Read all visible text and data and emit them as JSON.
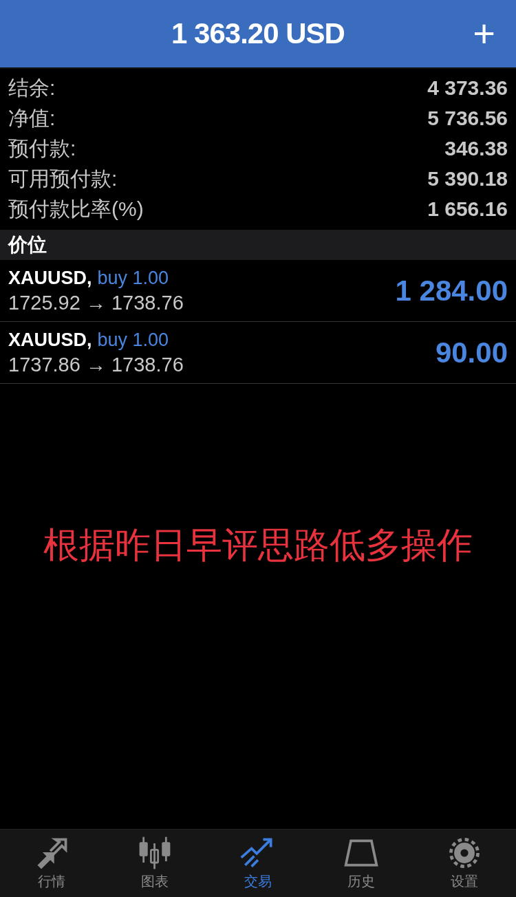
{
  "header": {
    "title": "1 363.20 USD",
    "add_icon": "+"
  },
  "summary": [
    {
      "label": "结余:",
      "value": "4 373.36"
    },
    {
      "label": "净值:",
      "value": "5 736.56"
    },
    {
      "label": "预付款:",
      "value": "346.38"
    },
    {
      "label": "可用预付款:",
      "value": "5 390.18"
    },
    {
      "label": "预付款比率(%)",
      "value": "1 656.16"
    }
  ],
  "section_title": "价位",
  "positions": [
    {
      "symbol": "XAUUSD,",
      "side": "buy 1.00",
      "prices": "1725.92 → 1738.76",
      "profit": "1 284.00"
    },
    {
      "symbol": "XAUUSD,",
      "side": "buy 1.00",
      "prices": "1737.86 → 1738.76",
      "profit": "90.00"
    }
  ],
  "note": "根据昨日早评思路低多操作",
  "tabs": [
    {
      "label": "行情",
      "kind": "quotes",
      "selected": false
    },
    {
      "label": "图表",
      "kind": "chart",
      "selected": false
    },
    {
      "label": "交易",
      "kind": "trade",
      "selected": true
    },
    {
      "label": "历史",
      "kind": "history",
      "selected": false
    },
    {
      "label": "设置",
      "kind": "settings",
      "selected": false
    }
  ]
}
